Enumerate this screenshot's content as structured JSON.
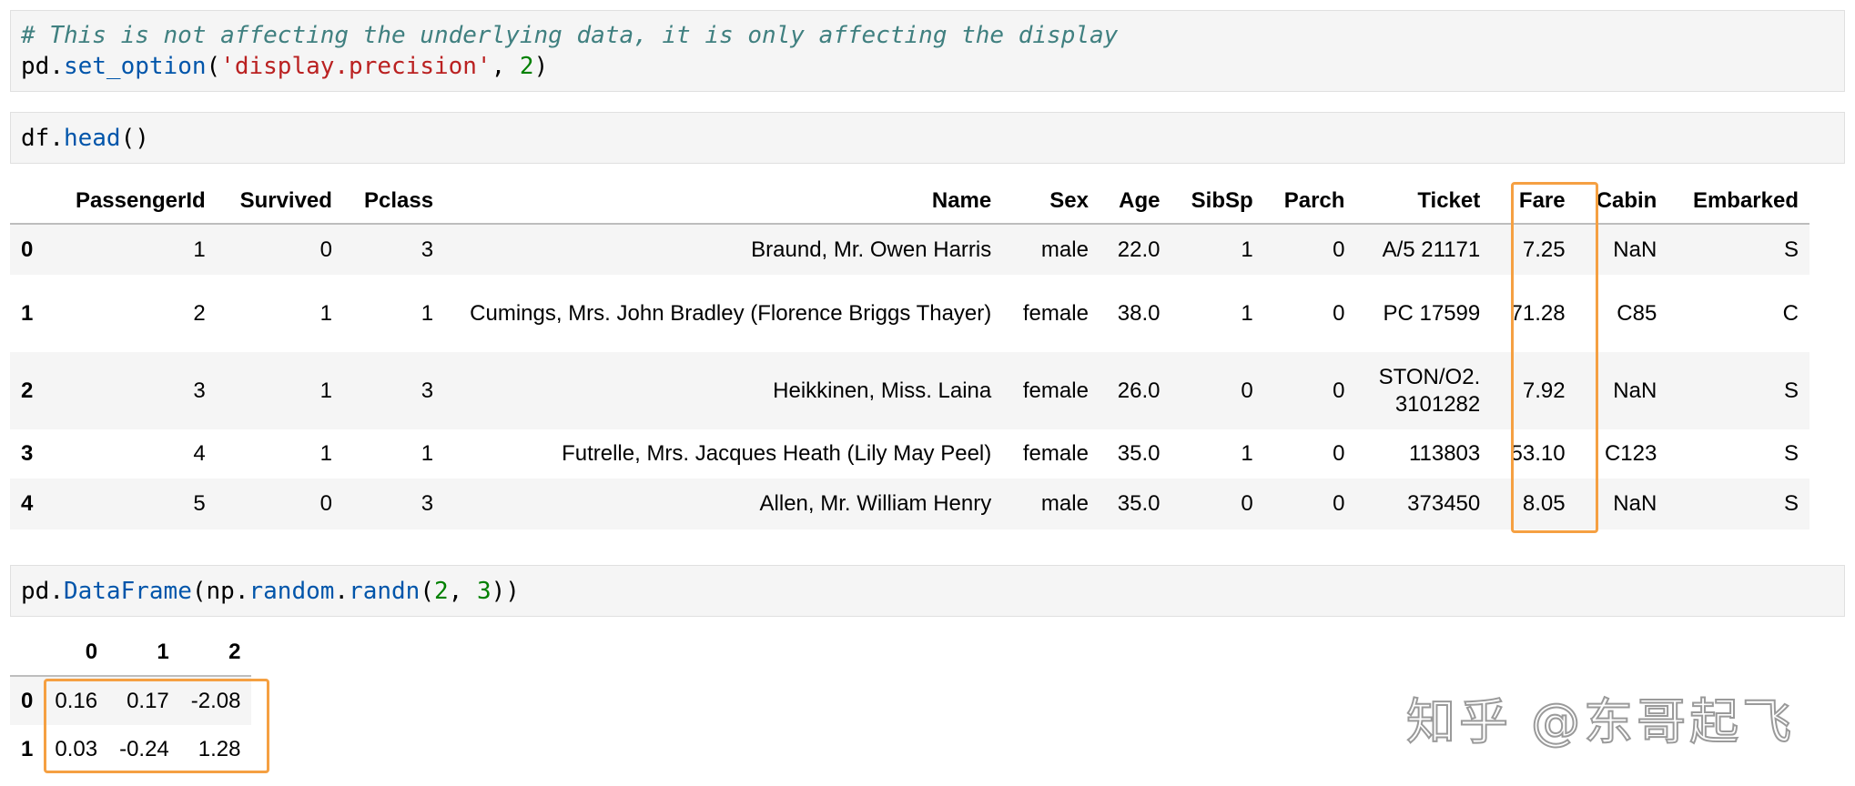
{
  "cell1": {
    "comment": "# This is not affecting the underlying data, it is only affecting the display",
    "code": {
      "obj": "pd",
      "dot": ".",
      "fn": "set_option",
      "open": "(",
      "arg_str": "'display.precision'",
      "sep": ", ",
      "arg_num": "2",
      "close": ")"
    }
  },
  "cell2": {
    "code": {
      "obj": "df",
      "dot": ".",
      "fn": "head",
      "parens": "()"
    }
  },
  "table1": {
    "columns": [
      "",
      "PassengerId",
      "Survived",
      "Pclass",
      "Name",
      "Sex",
      "Age",
      "SibSp",
      "Parch",
      "Ticket",
      "Fare",
      "Cabin",
      "Embarked"
    ],
    "rows": [
      [
        "0",
        "1",
        "0",
        "3",
        "Braund, Mr. Owen Harris",
        "male",
        "22.0",
        "1",
        "0",
        "A/5 21171",
        "7.25",
        "NaN",
        "S"
      ],
      [
        "1",
        "2",
        "1",
        "1",
        "Cumings, Mrs. John Bradley (Florence Briggs Thayer)",
        "female",
        "38.0",
        "1",
        "0",
        "PC 17599",
        "71.28",
        "C85",
        "C"
      ],
      [
        "2",
        "3",
        "1",
        "3",
        "Heikkinen, Miss. Laina",
        "female",
        "26.0",
        "0",
        "0",
        "STON/O2. 3101282",
        "7.92",
        "NaN",
        "S"
      ],
      [
        "3",
        "4",
        "1",
        "1",
        "Futrelle, Mrs. Jacques Heath (Lily May Peel)",
        "female",
        "35.0",
        "1",
        "0",
        "113803",
        "53.10",
        "C123",
        "S"
      ],
      [
        "4",
        "5",
        "0",
        "3",
        "Allen, Mr. William Henry",
        "male",
        "35.0",
        "0",
        "0",
        "373450",
        "8.05",
        "NaN",
        "S"
      ]
    ]
  },
  "cell3": {
    "code": {
      "obj": "pd",
      "dot1": ".",
      "fn1": "DataFrame",
      "open1": "(",
      "obj2": "np",
      "dot2": ".",
      "fn2": "random",
      "dot3": ".",
      "fn3": "randn",
      "open2": "(",
      "n1": "2",
      "sep": ", ",
      "n2": "3",
      "close": "))"
    }
  },
  "table2": {
    "columns": [
      "",
      "0",
      "1",
      "2"
    ],
    "rows": [
      [
        "0",
        "0.16",
        "0.17",
        "-2.08"
      ],
      [
        "1",
        "0.03",
        "-0.24",
        "1.28"
      ]
    ]
  },
  "watermark": "知乎 @东哥起飞",
  "colors": {
    "highlight": "#f5a042",
    "cell_bg": "#f5f5f5",
    "comment": "#408080",
    "function": "#0055aa",
    "string": "#ba2121",
    "number": "#008000"
  }
}
